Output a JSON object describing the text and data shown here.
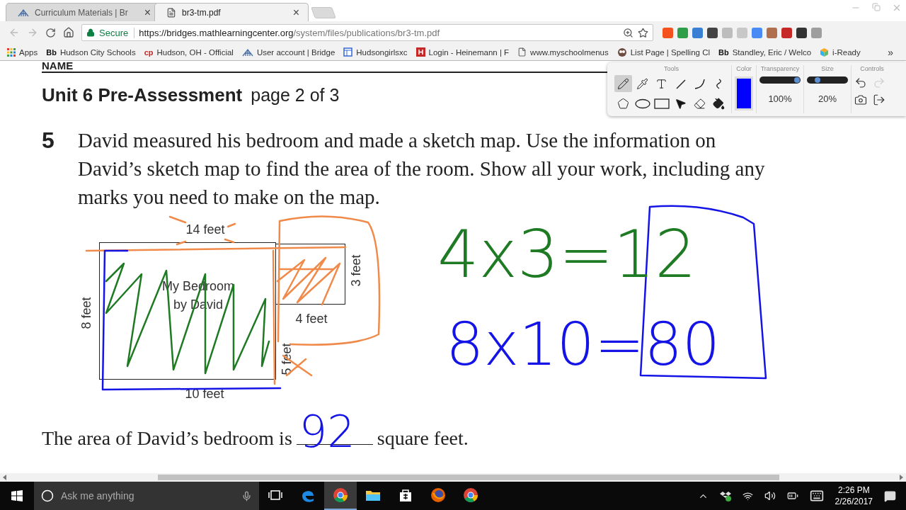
{
  "browser": {
    "tabs": [
      {
        "title": "Curriculum Materials | Br",
        "selected": false
      },
      {
        "title": "br3-tm.pdf",
        "selected": true
      }
    ],
    "close_glyph": "×",
    "address_bar": {
      "security": "Secure",
      "url_host": "https://bridges.mathlearningcenter.org",
      "url_path": "/system/files/publications/br3-tm.pdf"
    },
    "extensions": [
      {
        "color": "#f4511e"
      },
      {
        "color": "#2e9e48"
      },
      {
        "color": "#3b7fd4"
      },
      {
        "color": "#444444"
      },
      {
        "color": "#bdbdbd"
      },
      {
        "color": "#c8c8c8"
      },
      {
        "color": "#4a8af4"
      },
      {
        "color": "#b07050"
      },
      {
        "color": "#c62828"
      },
      {
        "color": "#333333"
      },
      {
        "color": "#9e9e9e"
      }
    ],
    "bookmarks": [
      {
        "label": "Apps"
      },
      {
        "badge": "Bb",
        "label": "Hudson City Schools"
      },
      {
        "badge": "cp",
        "label": "Hudson, OH - Official"
      },
      {
        "label": "User account | Bridge"
      },
      {
        "label": "Hudsongirlsxc"
      },
      {
        "label": "Login - Heinemann | F"
      },
      {
        "label": "www.myschoolmenus"
      },
      {
        "label": "List Page | Spelling Cl"
      },
      {
        "badge": "Bb",
        "label": "Standley, Eric / Welco"
      },
      {
        "label": "i-Ready"
      }
    ],
    "bookmarks_overflow": "»"
  },
  "document": {
    "name_label": "NAME",
    "title": "Unit 6 Pre-Assessment",
    "subtitle": "page 2 of 3",
    "question_number": "5",
    "question_text": "David measured his bedroom and made a sketch map. Use the information on David’s sketch map to find the area of the room. Show all your work, including any marks you need to make on the map.",
    "map_labels": {
      "top": "14 feet",
      "room": "My Bedroom",
      "room_owner": "by David",
      "closet_side": "3 feet",
      "closet_bottom": "4 feet",
      "left": "8 feet",
      "lower_side": "5 feet",
      "bottom": "10 feet"
    },
    "handwriting": [
      {
        "text": "4x3=12",
        "color": "#1e7a23"
      },
      {
        "text": "8x10=80",
        "color": "#1414e6"
      }
    ],
    "answer_before": "The area of David’s bedroom is",
    "answer": {
      "text": "92",
      "color": "#1414e6"
    },
    "answer_after": "square feet."
  },
  "annotation_toolbar": {
    "sections": [
      "Tools",
      "Color",
      "Transparency",
      "Size",
      "Controls"
    ],
    "tools": [
      {
        "kind": "pencil",
        "selected": true
      },
      {
        "kind": "eyedropper",
        "selected": false
      },
      {
        "kind": "text",
        "selected": false
      },
      {
        "kind": "line",
        "selected": false
      },
      {
        "kind": "curve",
        "selected": false
      },
      {
        "kind": "squiggle",
        "selected": false
      },
      {
        "kind": "polygon",
        "selected": false
      },
      {
        "kind": "ellipse",
        "selected": false
      },
      {
        "kind": "rectangle",
        "selected": false
      },
      {
        "kind": "pointer",
        "selected": false
      },
      {
        "kind": "eraser",
        "selected": false
      },
      {
        "kind": "fill",
        "selected": false
      }
    ],
    "color": "#0000ff",
    "transparency": {
      "level": 1,
      "reading": "100%"
    },
    "size": {
      "level": 0.2,
      "reading": "20%"
    },
    "controls": [
      {
        "kind": "undo",
        "disabled": false
      },
      {
        "kind": "redo",
        "disabled": true
      },
      {
        "kind": "camera",
        "disabled": false
      },
      {
        "kind": "exit",
        "disabled": false
      }
    ]
  },
  "taskbar": {
    "search_placeholder": "Ask me anything",
    "apps": [
      {
        "kind": "task-view",
        "active": false
      },
      {
        "kind": "edge",
        "active": false
      },
      {
        "kind": "chrome",
        "active": true
      },
      {
        "kind": "explorer",
        "active": false
      },
      {
        "kind": "store",
        "active": false
      },
      {
        "kind": "firefox",
        "active": false
      },
      {
        "kind": "chrome",
        "active": false
      }
    ],
    "time": "2:26 PM",
    "date": "2/26/2017"
  }
}
